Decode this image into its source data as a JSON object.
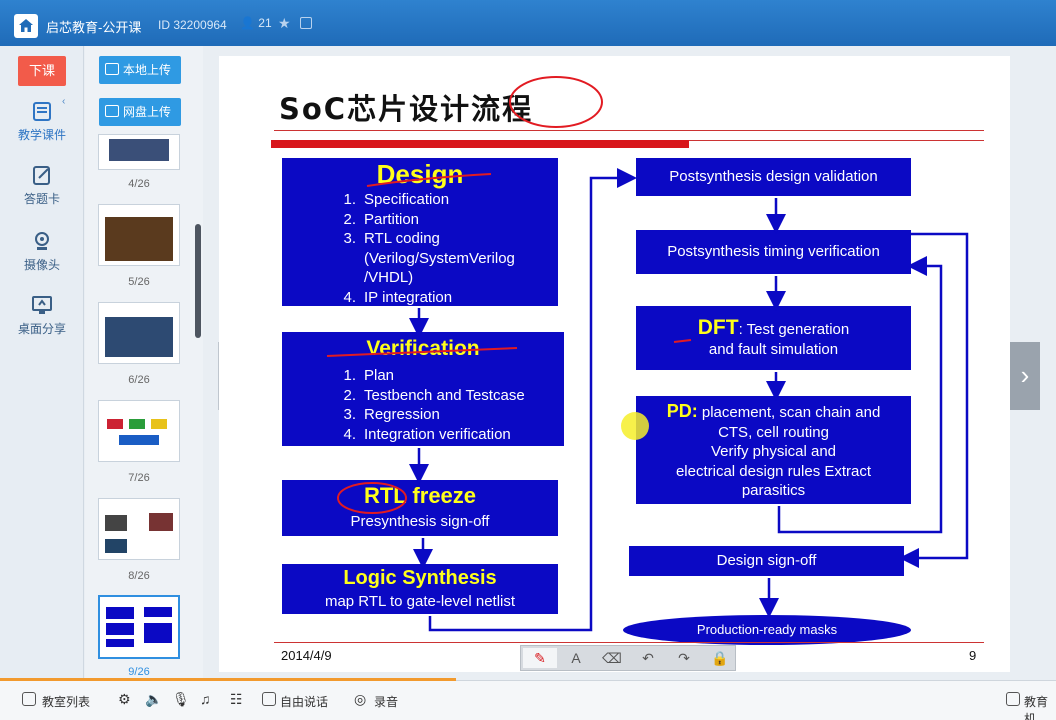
{
  "titlebar": {
    "title": "启芯教育-公开课",
    "room_id": "ID 32200964",
    "user_count": "21"
  },
  "leftnav": {
    "end_class": "下课",
    "items": [
      {
        "label": "教学课件",
        "icon": "courseware-icon"
      },
      {
        "label": "答题卡",
        "icon": "answer-card-icon"
      },
      {
        "label": "摄像头",
        "icon": "camera-icon"
      },
      {
        "label": "桌面分享",
        "icon": "screen-share-icon"
      }
    ]
  },
  "thumbs": {
    "upload_local": "本地上传",
    "upload_cloud": "网盘上传",
    "items": [
      {
        "label": "4/26"
      },
      {
        "label": "5/26"
      },
      {
        "label": "6/26"
      },
      {
        "label": "7/26"
      },
      {
        "label": "8/26"
      },
      {
        "label": "9/26"
      }
    ]
  },
  "slide": {
    "title": "SoC芯片设计流程",
    "design": {
      "heading": "Design",
      "items": [
        {
          "n": "1.",
          "t": "Specification"
        },
        {
          "n": "2.",
          "t": "Partition"
        },
        {
          "n": "3.",
          "t": "RTL coding"
        },
        {
          "n": "",
          "t": "(Verilog/SystemVerilog"
        },
        {
          "n": "",
          "t": "/VHDL)"
        },
        {
          "n": "4.",
          "t": "IP integration"
        }
      ]
    },
    "verification": {
      "heading": "Verification",
      "items": [
        {
          "n": "1.",
          "t": "Plan"
        },
        {
          "n": "2.",
          "t": "Testbench and Testcase"
        },
        {
          "n": "3.",
          "t": "Regression"
        },
        {
          "n": "4.",
          "t": "Integration verification"
        }
      ]
    },
    "rtl_freeze": {
      "heading": "RTL freeze",
      "sub": "Presynthesis sign-off"
    },
    "logic_synthesis": {
      "heading": "Logic Synthesis",
      "sub": "map RTL to gate-level netlist"
    },
    "post_validation": "Postsynthesis design validation",
    "post_timing": "Postsynthesis timing verification",
    "dft": {
      "heading": "DFT",
      "line1": ": Test generation",
      "line2": "and fault simulation"
    },
    "pd": {
      "heading": "PD:",
      "line1": " placement, scan chain and",
      "line2": "CTS, cell routing",
      "line3": "Verify physical and",
      "line4": "electrical design rules Extract",
      "line5": "parasitics"
    },
    "signoff": "Design sign-off",
    "masks": "Production-ready masks",
    "date": "2014/4/9",
    "page": "9"
  },
  "bottombar": {
    "classroom_list": "教室列表",
    "free_talk": "自由说话",
    "record": "录音",
    "right_label": "教育机"
  },
  "colors": {
    "titlebar": "#1f6bb8",
    "slide_box": "#0b09c4",
    "highlight_text": "#ffff1a",
    "accent_red": "#d8161b",
    "end_class_btn": "#f25b4a"
  }
}
